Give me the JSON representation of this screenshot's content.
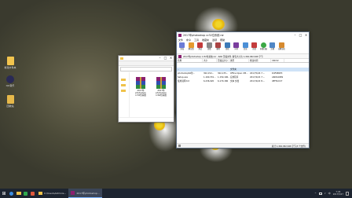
{
  "desktop": {
    "icons": [
      {
        "label": "新建文件夹"
      },
      {
        "label": "QQ音乐"
      },
      {
        "label": "回收站"
      }
    ]
  },
  "explorer": {
    "title": "",
    "files": [
      {
        "label": "2017年photoshop cc32位系统",
        "color": "#8a1f6f"
      },
      {
        "label": "2017年photoshop cc64位系统",
        "color": "#8a1f6f"
      }
    ]
  },
  "winrar": {
    "title": "2017年photoshop cc32位系统.rar",
    "menu": [
      "文件",
      "命令",
      "工具",
      "收藏夹",
      "选项",
      "帮助"
    ],
    "toolbar": [
      {
        "label": "添加",
        "icon": "add-icon",
        "color": "#6b7bd6"
      },
      {
        "label": "解压到",
        "icon": "extract-icon",
        "color": "#e59a2e"
      },
      {
        "label": "测试",
        "icon": "test-icon",
        "color": "#c23a3a"
      },
      {
        "label": "查看",
        "icon": "view-icon",
        "color": "#888"
      },
      {
        "label": "删除",
        "icon": "delete-icon",
        "color": "#aa4444"
      },
      {
        "label": "查找",
        "icon": "find-icon",
        "color": "#3c7ab8"
      },
      {
        "label": "向导",
        "icon": "wizard-icon",
        "color": "#7a3e9e"
      },
      {
        "label": "信息",
        "icon": "info-icon",
        "color": "#4b8fd6"
      },
      {
        "label": "修复",
        "icon": "repair-icon",
        "color": "#c43c3c"
      },
      {
        "label": "病毒扫描",
        "icon": "virus-scan-icon",
        "color": "#3ba845"
      },
      {
        "label": "注释",
        "icon": "comment-icon",
        "color": "#4f86c5"
      },
      {
        "label": "自解压格式",
        "icon": "sfx-icon",
        "color": "#d68a2e"
      }
    ],
    "path": "2017年photoshop cc32位系统.rar - RAR 压缩文件, 解包大小为 1,462,062,646 字节",
    "columns": [
      "名称",
      "大小",
      "压缩后大小",
      "类型",
      "修改时间",
      "CRC32"
    ],
    "rows": [
      {
        "name": "..",
        "size": "",
        "packed": "",
        "type": "文件夹",
        "modified": "",
        "crc": ""
      },
      {
        "name": "photoshop64位...",
        "size": "302,152...",
        "packed": "302,135...",
        "type": "Office Open XM...",
        "modified": "2017/5/26 7:...",
        "crc": "D4F6E6E3"
      },
      {
        "name": "Setup.exe",
        "size": "1,160,331...",
        "packed": "1,150,196...",
        "type": "应用程序",
        "modified": "2017/4/22 7:...",
        "crc": "A6DDA689"
      },
      {
        "name": "使用说明.txt",
        "size": "6,236,920",
        "packed": "6,170,186",
        "type": "文本 文档",
        "modified": "2017/4/22 8:...",
        "crc": "4EF81CC7"
      }
    ],
    "status": "总计 1,462,062,646 字节(3 个文件)"
  },
  "taskbar": {
    "apps": [
      {
        "label": "C:\\Users\\Adminis..."
      },
      {
        "label": "2017年photoshop..."
      }
    ],
    "tray_lang": "中",
    "time": "7:29",
    "date": "2017/5/27"
  }
}
